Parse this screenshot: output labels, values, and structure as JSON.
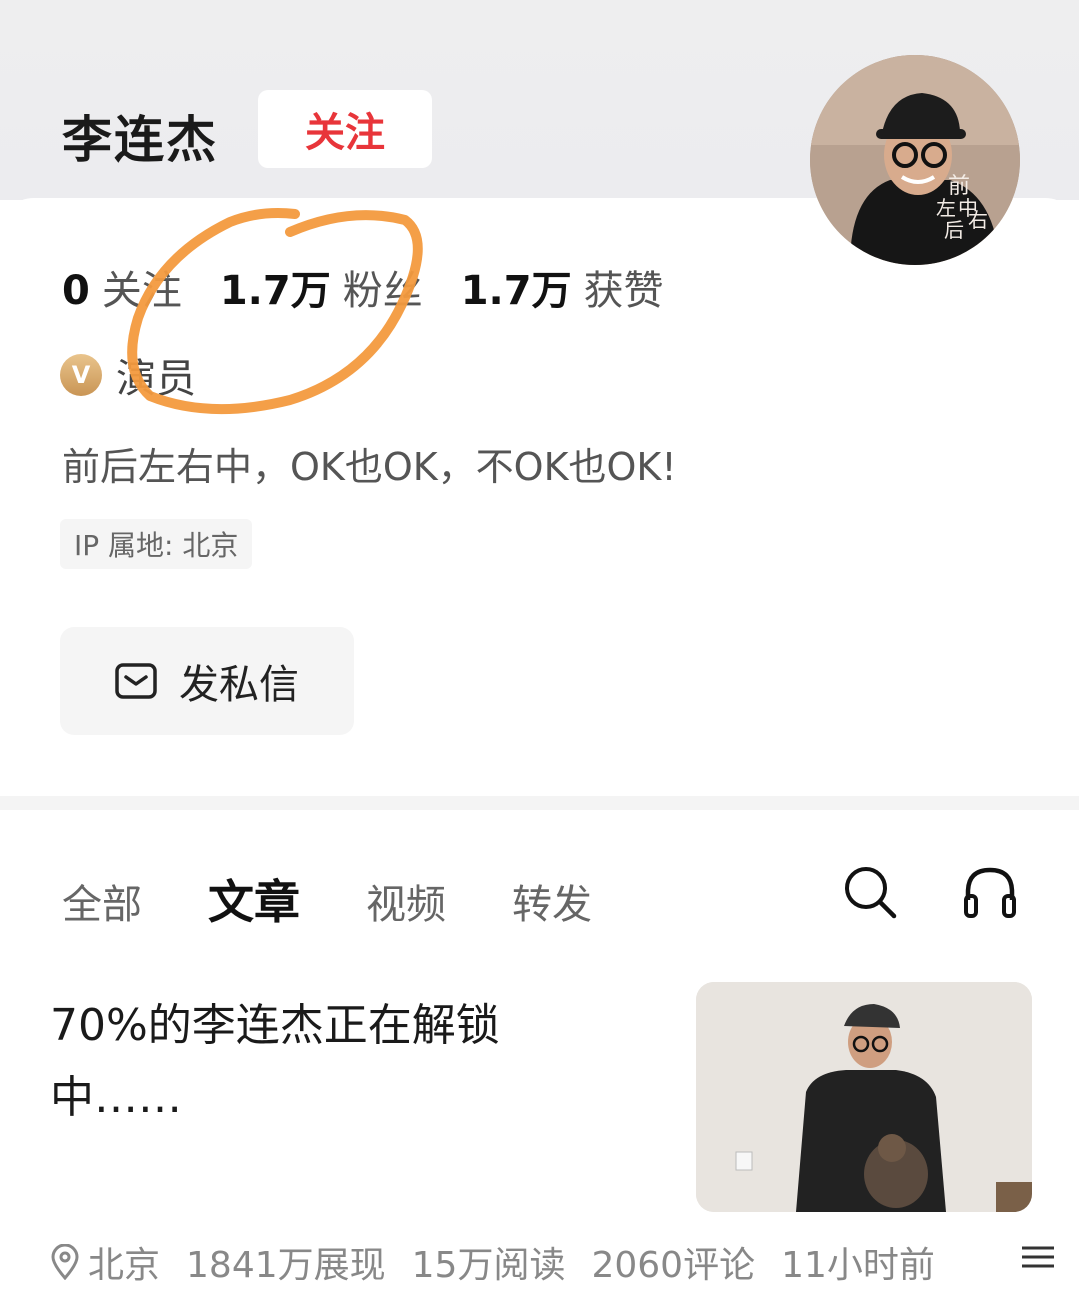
{
  "profile": {
    "name": "李连杰",
    "follow_label": "关注",
    "stats": [
      {
        "num": "0",
        "label": "关注"
      },
      {
        "num": "1.7万",
        "label": "粉丝"
      },
      {
        "num": "1.7万",
        "label": "获赞"
      }
    ],
    "verified_badge": "V",
    "verified_title": "演员",
    "bio": "前后左右中，OK也OK，不OK也OK!",
    "ip_location": "IP 属地: 北京",
    "dm_label": "发私信",
    "avatar_watermark": [
      "前",
      "左",
      "中",
      "后",
      "右"
    ]
  },
  "tabs": [
    {
      "label": "全部",
      "active": false
    },
    {
      "label": "文章",
      "active": true
    },
    {
      "label": "视频",
      "active": false
    },
    {
      "label": "转发",
      "active": false
    }
  ],
  "article": {
    "title": "70%的李连杰正在解锁中……",
    "location": "北京",
    "impressions": "1841万展现",
    "reads": "15万阅读",
    "comments": "2060评论",
    "time": "11小时前"
  },
  "icons": {
    "search": "search-icon",
    "headphones": "headphones-icon",
    "mail": "mail-icon",
    "location": "location-pin-icon",
    "more": "more-lines-icon"
  },
  "colors": {
    "follow_red": "#e8353a",
    "verified_gold": "#d4a86a",
    "annotation_orange": "#f39a3e"
  }
}
